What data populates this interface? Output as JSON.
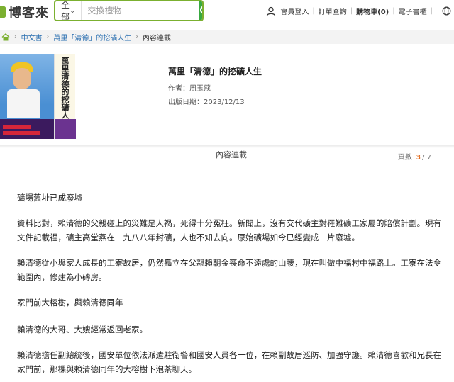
{
  "header": {
    "logo_text": "博客來",
    "search": {
      "category": "全部",
      "placeholder": "交換禮物"
    },
    "links": {
      "login": "會員登入",
      "order": "訂單查詢",
      "cart": "購物車(0)",
      "ebook": "電子書櫃"
    }
  },
  "breadcrumb": {
    "items": [
      "中文書",
      "萬里「清德」的挖礦人生",
      "內容連載"
    ]
  },
  "book": {
    "title": "萬里「清德」的挖礦人生",
    "author": "作者：周玉蔻",
    "date": "出版日期：2023/12/13",
    "cover_text": "萬里清德的挖礦人生",
    "cover_highlight": "清德"
  },
  "section": {
    "title": "內容連載",
    "page_label": "頁數",
    "page_current": "3",
    "page_total": "/ 7"
  },
  "article": {
    "p1": "礦場舊址已成廢墟",
    "p2": "資料比對，賴清德的父親碰上的災難是人禍，死得十分冤枉。新聞上，沒有交代礦主對罹難礦工家屬的賠償計劃。現有文件記載裡，礦主高堂燕在一九八八年封礦，人也不知去向。原始礦場如今已經變成一片廢墟。",
    "p3": "賴清德從小與家人成長的工寮故居，仍然矗立在父親賴朝金喪命不遠處的山腰，現在叫做中福村中福路上。工寮在法令範圍內，修建為小磚房。",
    "p4": "家門前大榕樹，與賴清德同年",
    "p5": "賴清德的大哥、大嫂經常返回老家。",
    "p6": "賴清德擔任副總統後，國安單位依法派遣駐衛警和國安人員各一位，在賴副故居巡防、加強守護。賴清德喜歡和兄長在家門前，那棵與賴清德同年的大榕樹下泡茶聊天。"
  },
  "colors": {
    "brand_green": "#39a940",
    "link_blue": "#2a6fb0",
    "page_current": "#e26a1c"
  }
}
